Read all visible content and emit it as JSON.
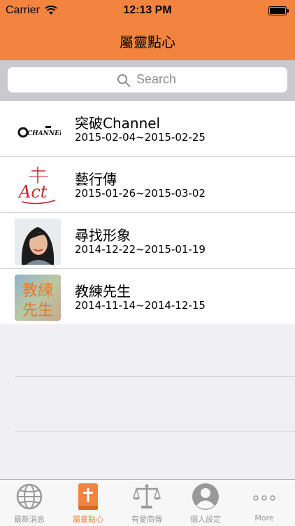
{
  "status_bar": {
    "carrier": "Carrier",
    "time": "12:13 PM"
  },
  "nav": {
    "title": "屬靈點心"
  },
  "search": {
    "placeholder": "Search"
  },
  "items": [
    {
      "title": "突破Channel",
      "date": "2015-02-04~2015-02-25",
      "thumb": "channel-logo",
      "logo_text": "CHANNEL"
    },
    {
      "title": "藝行傳",
      "date": "2015-01-26~2015-03-02",
      "thumb": "act-logo",
      "logo_text": "Act"
    },
    {
      "title": "尋找形象",
      "date": "2014-12-22~2015-01-19",
      "thumb": "portrait-photo"
    },
    {
      "title": "教練先生",
      "date": "2014-11-14~2014-12-15",
      "thumb": "coach-image",
      "logo_text": "教練先生"
    }
  ],
  "tabs": [
    {
      "label": "最新消息",
      "icon": "globe-icon",
      "active": false
    },
    {
      "label": "屬靈點心",
      "icon": "bible-icon",
      "active": true
    },
    {
      "label": "有愛商傳",
      "icon": "scales-icon",
      "active": false
    },
    {
      "label": "個人設定",
      "icon": "person-icon",
      "active": false
    },
    {
      "label": "More",
      "icon": "more-icon",
      "active": false
    }
  ],
  "colors": {
    "accent": "#f3843f",
    "tab_inactive": "#999999",
    "background": "#efeff4"
  }
}
